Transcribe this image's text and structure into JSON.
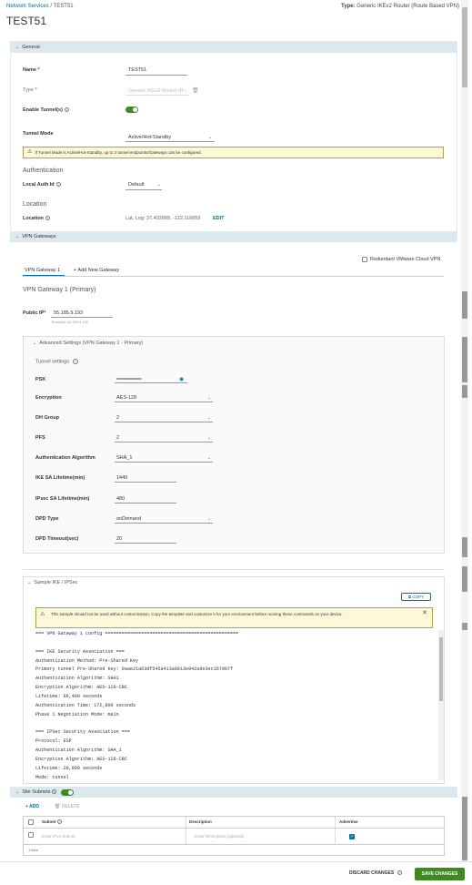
{
  "breadcrumb": {
    "parent": "Network Services",
    "separator": "/",
    "current": "TEST51"
  },
  "type_info": {
    "label": "Type:",
    "value": "Generic IKEv2 Router (Route Based VPN)"
  },
  "page_title": "TEST51",
  "general": {
    "header": "General",
    "name_label": "Name",
    "name_value": "TEST51",
    "type_label": "Type",
    "type_value": "Generic IKEv2 Router (R",
    "enable_label": "Enable Tunnel(s)",
    "tunnel_mode_label": "Tunnel Mode",
    "tunnel_mode_value": "Active/Hot-Standby",
    "warning": "If Tunnel Mode is Active/Hot-Standby, up to 2 tunnel endpoints/Gateways can be configured.",
    "auth_heading": "Authentication",
    "local_auth_label": "Local Auth Id",
    "local_auth_value": "Default",
    "location_heading": "Location",
    "location_label": "Location",
    "location_value": "Lat, Lng: 37.402889, -122.116859",
    "edit_label": "EDIT"
  },
  "vpn": {
    "header": "VPN Gateways",
    "redundant_label": "Redundant VMware Cloud VPN",
    "tab_active": "VPN Gateway 1",
    "tab_add": "+ Add New Gateway",
    "gateway_heading": "VPN Gateway 1 (Primary)",
    "public_ip_label": "Public IP",
    "public_ip_value": "55.185.9.193",
    "public_ip_hint": "Example 54.183.9.192",
    "advanced_header": "Advanced Settings (VPN Gateway 1 - Primary)",
    "tunnel_settings_label": "Tunnel settings",
    "fields": {
      "psk_label": "PSK",
      "psk_value": "••••••••••••••••••••••••••••••••••",
      "encryption_label": "Encryption",
      "encryption_value": "AES-128",
      "dh_label": "DH Group",
      "dh_value": "2",
      "pfs_label": "PFS",
      "pfs_value": "2",
      "auth_alg_label": "Authentication Algorithm",
      "auth_alg_value": "SHA_1",
      "ike_label": "IKE SA Lifetime(min)",
      "ike_value": "1440",
      "ipsec_label": "IPsec SA Lifetime(min)",
      "ipsec_value": "480",
      "dpd_type_label": "DPD Type",
      "dpd_type_value": "onDemand",
      "dpd_timeout_label": "DPD Timeout(sec)",
      "dpd_timeout_value": "20"
    }
  },
  "sample": {
    "header": "Sample IKE / IPSec",
    "copy_label": "COPY",
    "warning": "This sample should not be used without customization. Copy the template and customize it for your environment before running these commands on your device.",
    "code": "=== VPN Gateway 1 config ================================================\n\n=== IKE Security Association ===\nAuthentication Method: Pre-Shared Key\nPrimary tunnel Pre-Shared Key: 9aae21a63df545a413a8813e942ade3ec1b7d07f\nAuthentication Algorithm: SHA1\nEncryption Algorithm: AES-128-CBC\nLifetime: 86,400 seconds\nAuthentication Time: 172,800 seconds\nPhase 1 Negotiation Mode: main\n\n=== IPSec Security Association ===\nProtocol: ESP\nAuthentication Algorithm: SHA_1\nEncryption Algorithm: AES-128-CBC\nLifetime: 28,800 seconds\nMode: tunnel"
  },
  "site_subnets": {
    "header": "Site Subnets",
    "add_label": "ADD",
    "delete_label": "DELETE",
    "columns": {
      "subnet": "Subnet",
      "description": "Description",
      "advertise": "Advertise"
    },
    "row": {
      "subnet_placeholder": "Enter IPv4 Subnet",
      "description_placeholder": "Enter Description (optional)"
    },
    "count": "1 item"
  },
  "footer": {
    "discard_label": "DISCARD CHANGES",
    "save_label": "SAVE CHANGES"
  },
  "colors": {
    "accent": "#0072a3",
    "success": "#3e8a1d",
    "section_header": "#dde7ee",
    "warning_bg": "#fef8d9"
  }
}
